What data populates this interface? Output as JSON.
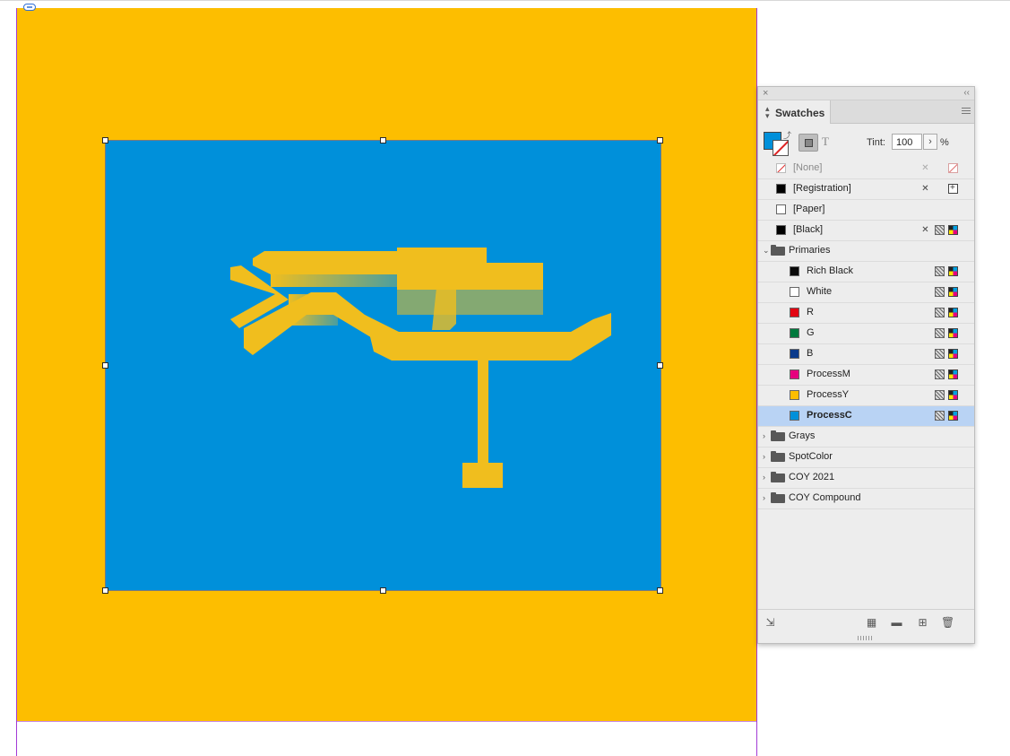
{
  "document": {
    "page_color": "#FDBE00",
    "frame_fill": "#0090DA",
    "artwork_color": "#F0BE1E"
  },
  "swatches_panel": {
    "title": "Swatches",
    "tint_label": "Tint:",
    "tint_value": "100",
    "tint_unit": "%",
    "fill_color": "#0090DA",
    "system_swatches": [
      {
        "label": "[None]"
      },
      {
        "label": "[Registration]"
      },
      {
        "label": "[Paper]"
      },
      {
        "label": "[Black]"
      }
    ],
    "group_open": "Primaries",
    "primaries": [
      {
        "label": "Rich Black",
        "color": "#0a0a0a"
      },
      {
        "label": "White",
        "color": "#ffffff"
      },
      {
        "label": "R",
        "color": "#e30613"
      },
      {
        "label": "G",
        "color": "#007a3d"
      },
      {
        "label": "B",
        "color": "#0b3b8c"
      },
      {
        "label": "ProcessM",
        "color": "#e6007e"
      },
      {
        "label": "ProcessY",
        "color": "#fdbe00"
      },
      {
        "label": "ProcessC",
        "color": "#0090da",
        "selected": true
      }
    ],
    "groups_closed": [
      {
        "label": "Grays"
      },
      {
        "label": "SpotColor"
      },
      {
        "label": "COY 2021"
      },
      {
        "label": "COY Compound"
      }
    ]
  }
}
